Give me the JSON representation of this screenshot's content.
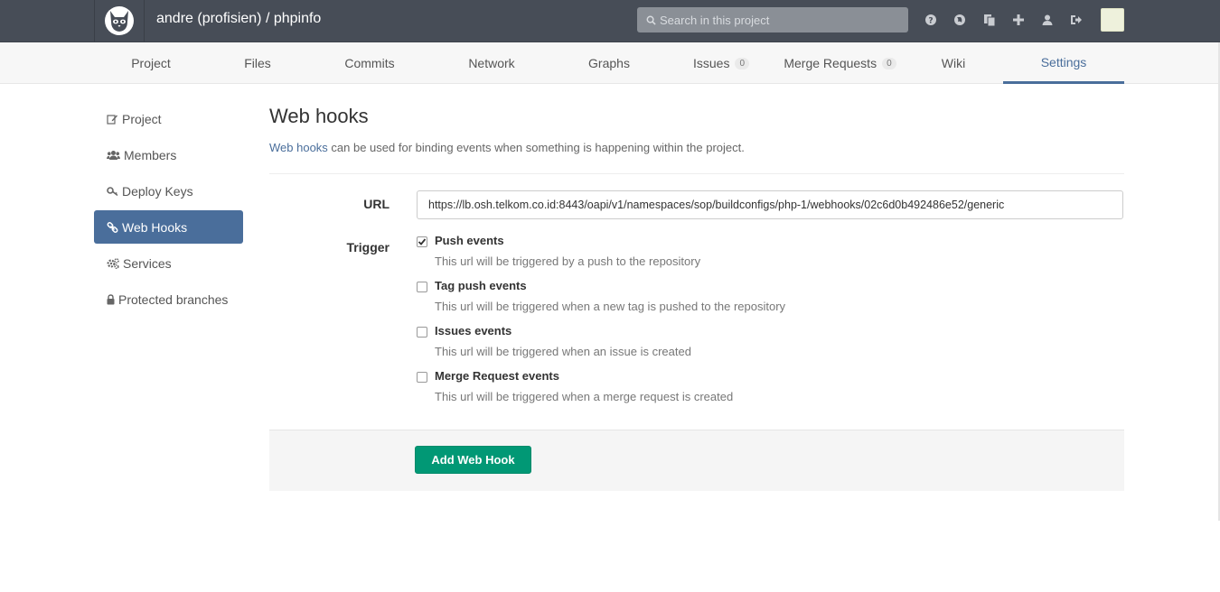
{
  "header": {
    "project_title": "andre (profisien) / phpinfo",
    "search_placeholder": "Search in this project",
    "icons": [
      "help-icon",
      "globe-icon",
      "copy-icon",
      "plus-icon",
      "user-icon",
      "sign-out-icon"
    ]
  },
  "nav": {
    "tabs": [
      {
        "label": "Project"
      },
      {
        "label": "Files"
      },
      {
        "label": "Commits"
      },
      {
        "label": "Network"
      },
      {
        "label": "Graphs"
      },
      {
        "label": "Issues",
        "badge": "0"
      },
      {
        "label": "Merge Requests",
        "badge": "0"
      },
      {
        "label": "Wiki"
      },
      {
        "label": "Settings",
        "active": true
      }
    ]
  },
  "sidebar": {
    "items": [
      {
        "label": "Project",
        "icon": "edit-icon"
      },
      {
        "label": "Members",
        "icon": "users-icon"
      },
      {
        "label": "Deploy Keys",
        "icon": "key-icon"
      },
      {
        "label": "Web Hooks",
        "icon": "link-icon",
        "active": true
      },
      {
        "label": "Services",
        "icon": "cogs-icon"
      },
      {
        "label": "Protected branches",
        "icon": "lock-icon"
      }
    ]
  },
  "main": {
    "title": "Web hooks",
    "lead_link": "Web hooks",
    "lead_text": " can be used for binding events when something is happening within the project.",
    "url_label": "URL",
    "url_value": "https://lb.osh.telkom.co.id:8443/oapi/v1/namespaces/sop/buildconfigs/php-1/webhooks/02c6d0b492486e52/generic",
    "trigger_label": "Trigger",
    "triggers": [
      {
        "label": "Push events",
        "help": "This url will be triggered by a push to the repository",
        "checked": true
      },
      {
        "label": "Tag push events",
        "help": "This url will be triggered when a new tag is pushed to the repository",
        "checked": false
      },
      {
        "label": "Issues events",
        "help": "This url will be triggered when an issue is created",
        "checked": false
      },
      {
        "label": "Merge Request events",
        "help": "This url will be triggered when a merge request is created",
        "checked": false
      }
    ],
    "submit_label": "Add Web Hook"
  },
  "colors": {
    "header_bg": "#474d57",
    "accent": "#4a6e9b",
    "submit": "#019875"
  }
}
